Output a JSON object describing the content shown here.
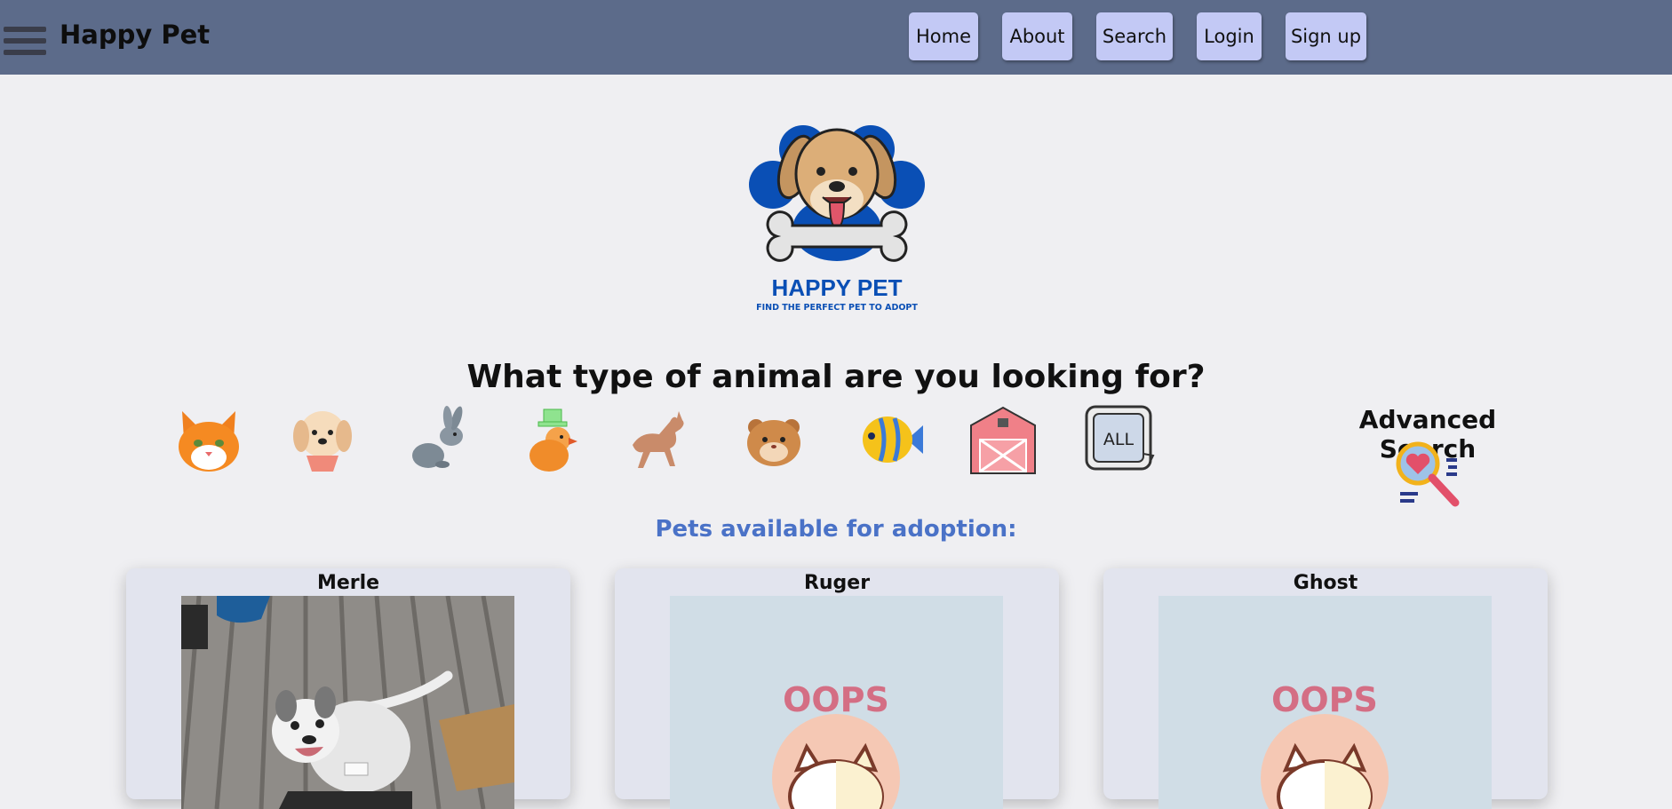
{
  "header": {
    "brand": "Happy Pet",
    "nav": [
      "Home",
      "About",
      "Search",
      "Login",
      "Sign up"
    ]
  },
  "logo": {
    "title": "HAPPY PET",
    "tagline": "FIND THE PERFECT PET TO ADOPT"
  },
  "animal_section": {
    "question": "What type of animal are you looking for?",
    "icons": [
      "cat-icon",
      "dog-icon",
      "rabbit-icon",
      "bird-icon",
      "horse-icon",
      "hamster-icon",
      "fish-icon",
      "barn-icon",
      "all-animals-icon"
    ],
    "all_label": "ALL"
  },
  "advanced_search": {
    "title": "Advanced Search",
    "icon": "magnifier-heart-icon"
  },
  "pets_section": {
    "heading": "Pets available for adoption:",
    "oops_text": "OOPS",
    "pets": [
      {
        "name": "Merle",
        "photo": "dog-photo"
      },
      {
        "name": "Ruger",
        "photo": "oops-placeholder"
      },
      {
        "name": "Ghost",
        "photo": "oops-placeholder"
      }
    ]
  },
  "colors": {
    "navbar": "#5c6b8a",
    "nav_button": "#c3c9f5",
    "background": "#efeff2",
    "accent_heading": "#4a72c7",
    "card": "#e2e4ee",
    "placeholder": "#d0dde6",
    "logo_blue": "#0a4fb5"
  }
}
